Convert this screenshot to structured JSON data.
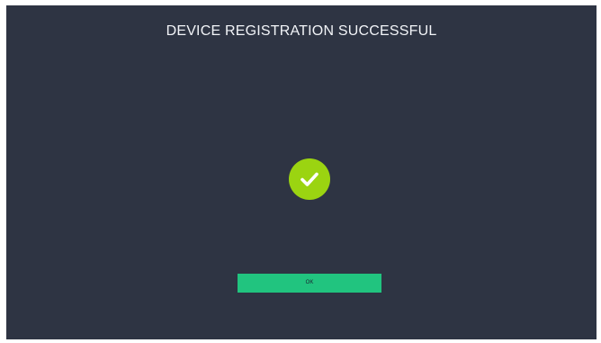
{
  "screen": {
    "title": "DEVICE REGISTRATION SUCCESSFUL",
    "status_icon": "check-circle-icon",
    "ok_button_label": "OK"
  },
  "colors": {
    "background": "#2e3443",
    "success_icon": "#9bd411",
    "ok_button": "#21c47f",
    "title_text": "#f2f4f8"
  }
}
